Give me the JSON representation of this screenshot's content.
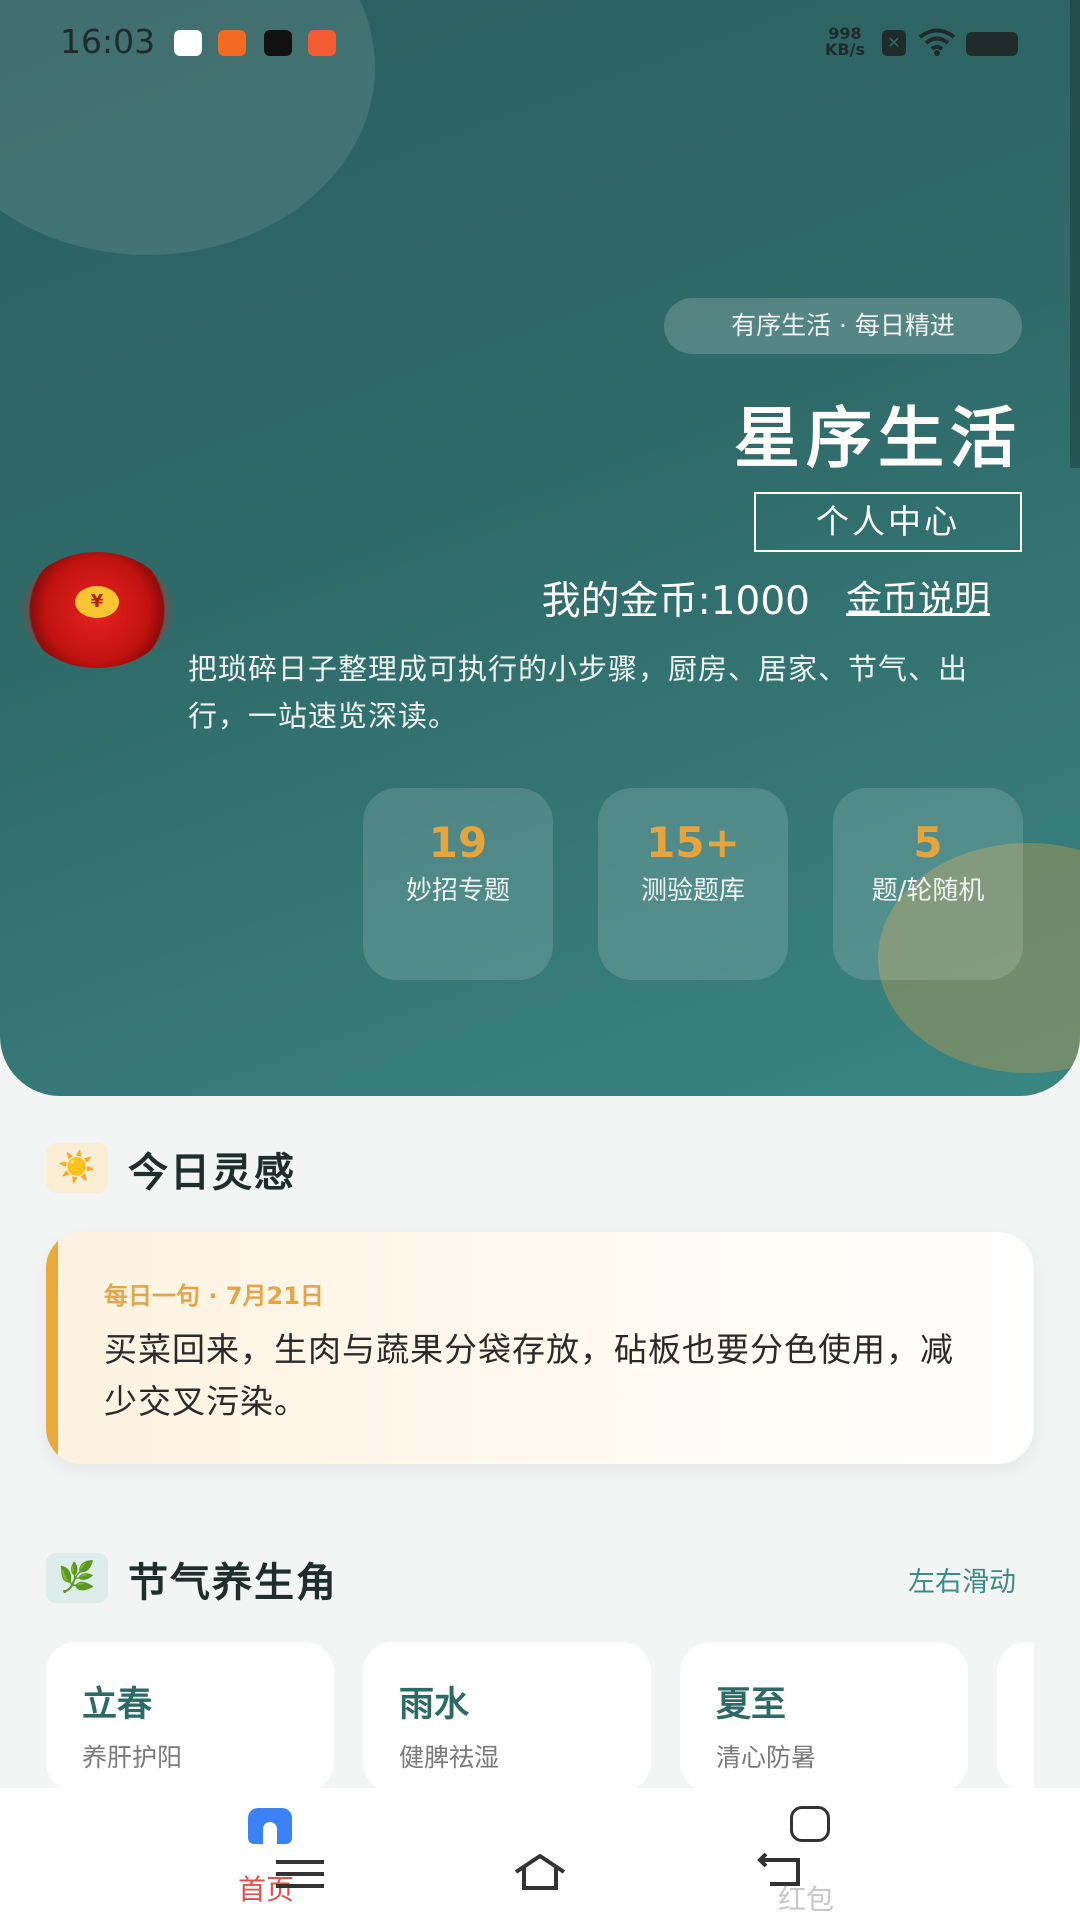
{
  "status_bar": {
    "time": "16:03",
    "net_speed_value": "998",
    "net_speed_unit": "KB/s",
    "app_icons": [
      "baidu-icon",
      "kuaishou-icon",
      "douyin-icon",
      "kuaishou-lite-icon"
    ]
  },
  "hero": {
    "tagline": "有序生活 · 每日精进",
    "title": "星序生活",
    "personal_center_label": "个人中心",
    "coins_text": "我的金币:1000",
    "coins_explain_link": "金币说明",
    "intro": "把琐碎日子整理成可执行的小步骤，厨房、居家、节气、出行，一站速览深读。",
    "stats": [
      {
        "value": "19",
        "label": "妙招专题"
      },
      {
        "value": "15+",
        "label": "测验题库"
      },
      {
        "value": "5",
        "label": "题/轮随机"
      }
    ],
    "red_packet_symbol": "¥"
  },
  "inspiration": {
    "icon": "☀️",
    "title": "今日灵感",
    "card_date": "每日一句 · 7月21日",
    "card_text": "买菜回来，生肉与蔬果分袋存放，砧板也要分色使用，减少交叉污染。"
  },
  "solar_terms": {
    "icon": "🌿",
    "title": "节气养生角",
    "swipe_hint": "左右滑动",
    "cards": [
      {
        "name": "立春",
        "desc": "养肝护阳"
      },
      {
        "name": "雨水",
        "desc": "健脾祛湿"
      },
      {
        "name": "夏至",
        "desc": "清心防暑"
      }
    ]
  },
  "bottom_nav": {
    "home_label": "首页",
    "red_packet_label": "红包"
  },
  "colors": {
    "hero_start": "#2c5e5e",
    "hero_end": "#3a8583",
    "accent_gold": "#e6a53c",
    "accent_teal": "#2d6a66",
    "active_tab": "#e0524a"
  }
}
